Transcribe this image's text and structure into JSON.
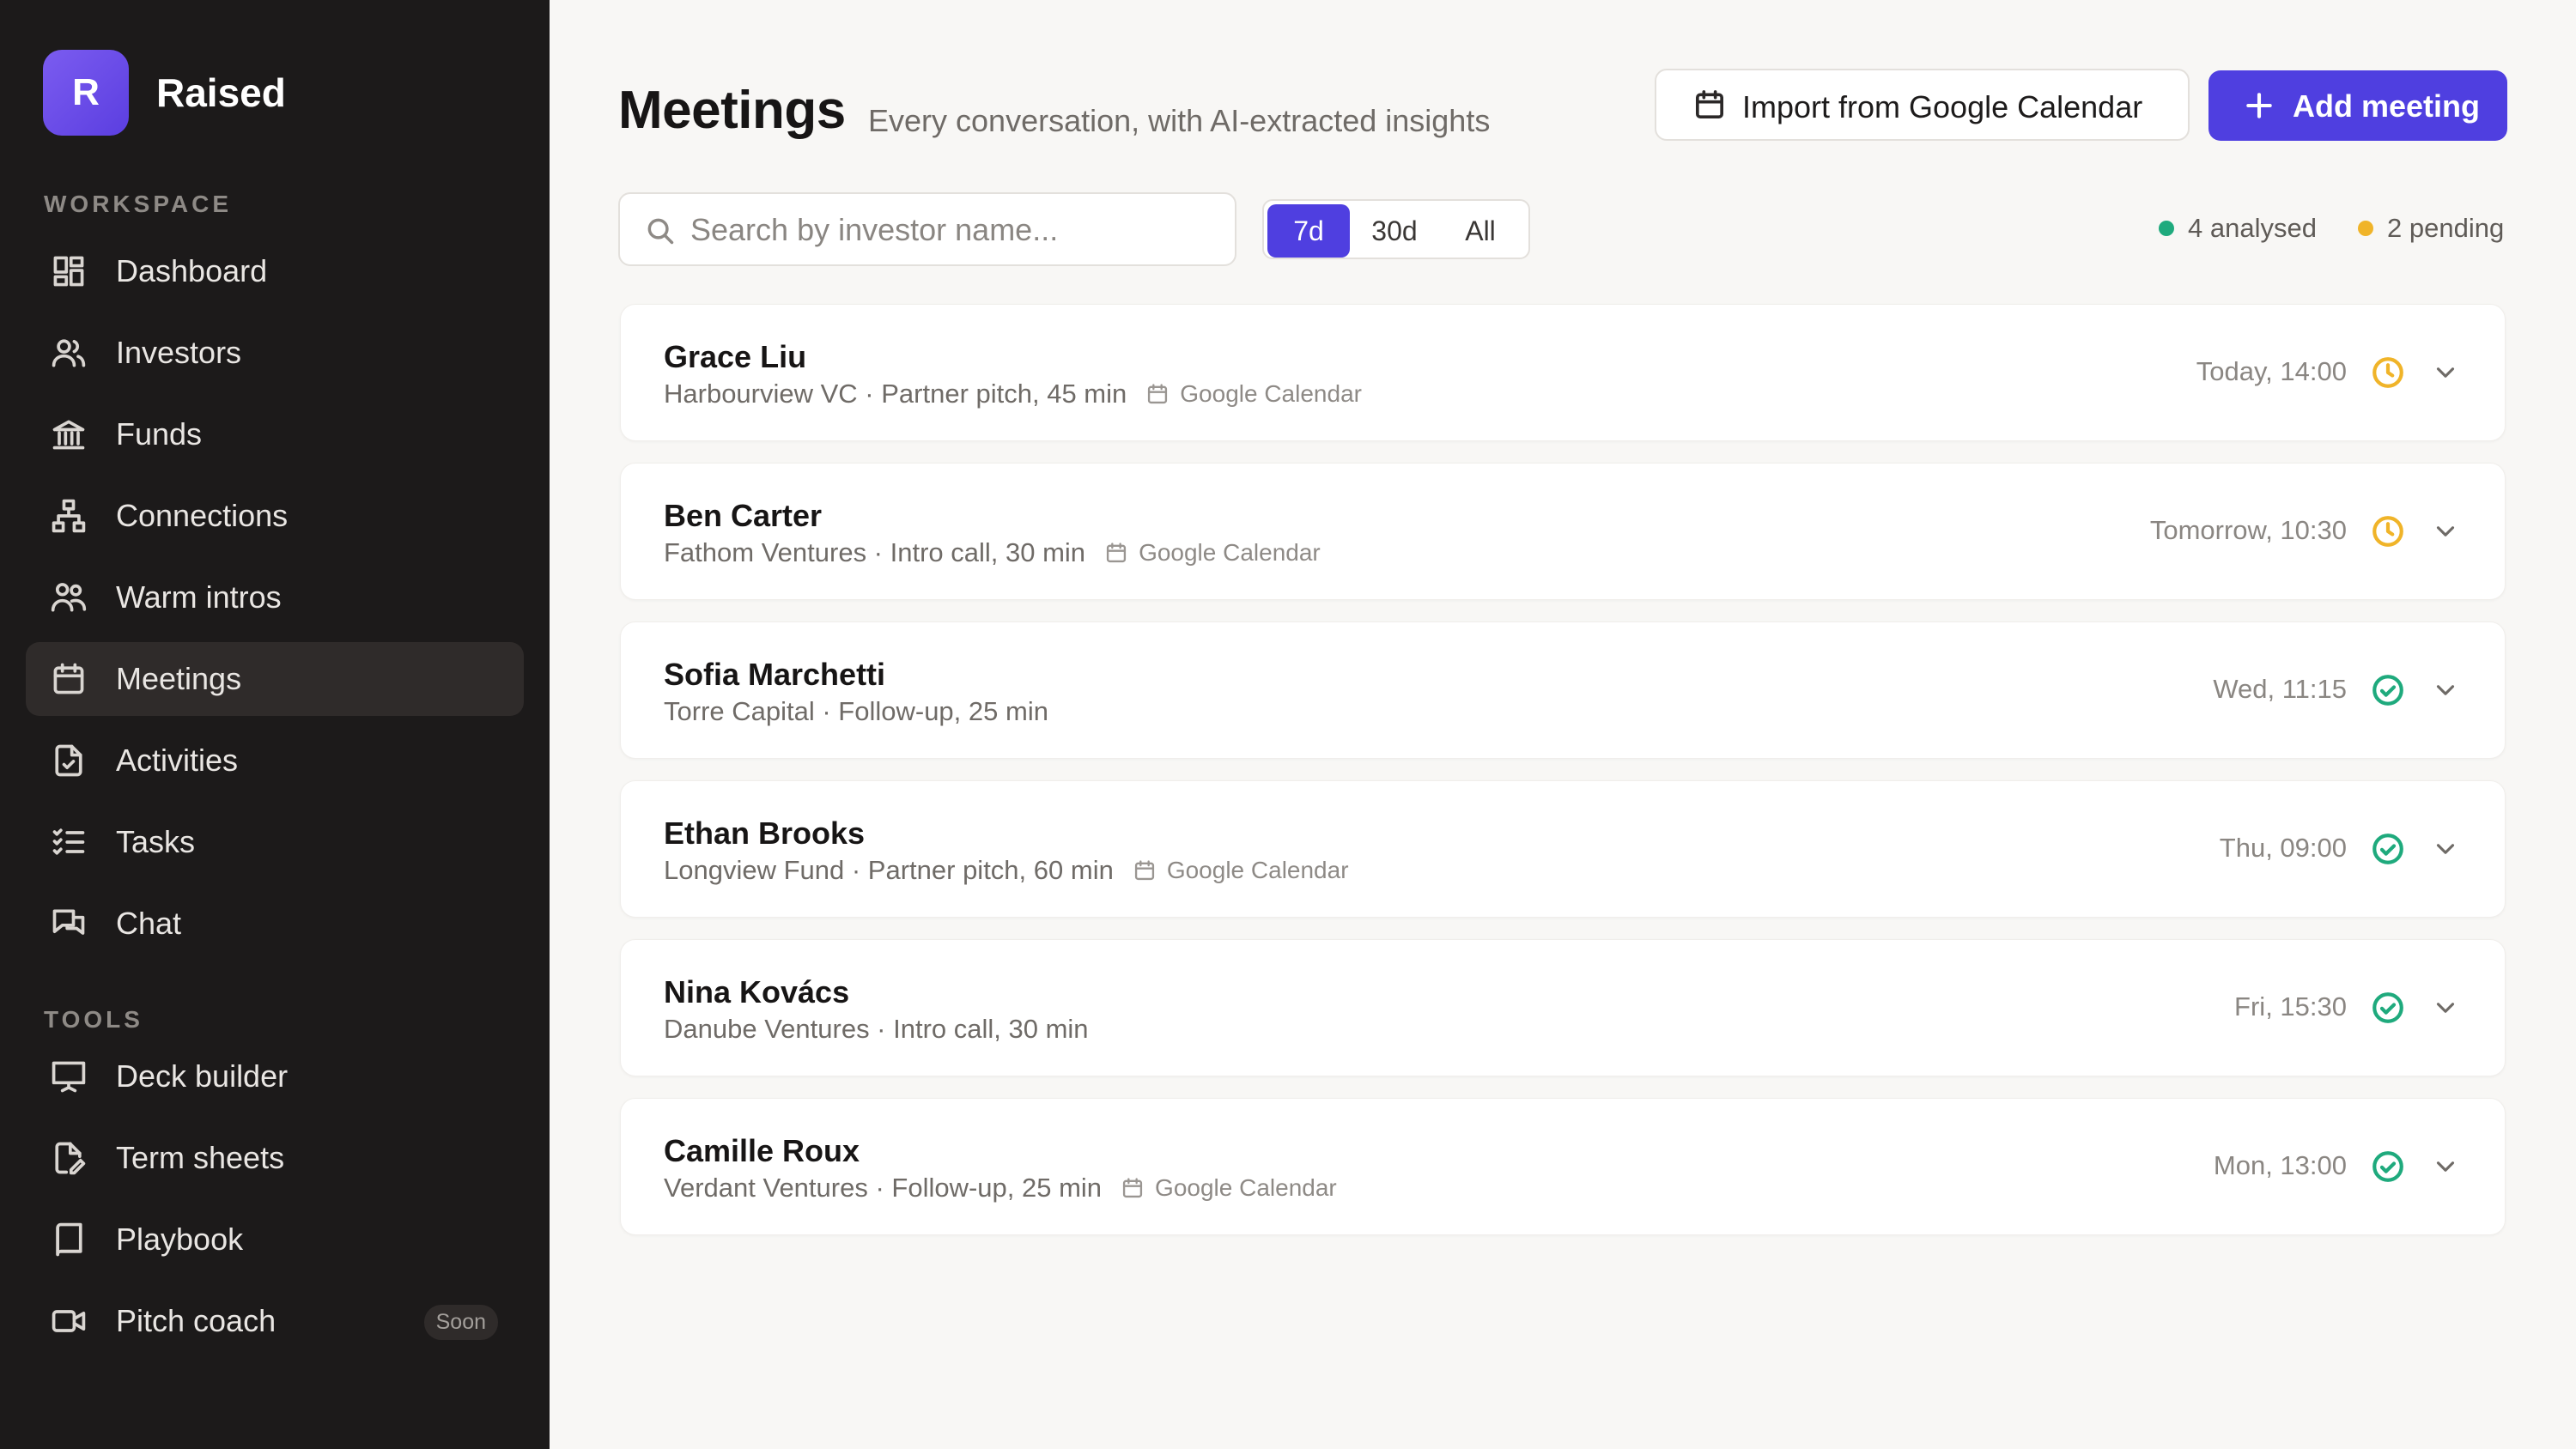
{
  "app": {
    "logo_letter": "R",
    "name": "Raised"
  },
  "sidebar": {
    "workspace_label": "WORKSPACE",
    "tools_label": "TOOLS",
    "workspace_items": [
      {
        "label": "Dashboard",
        "icon": "dashboard-icon"
      },
      {
        "label": "Investors",
        "icon": "users-icon"
      },
      {
        "label": "Funds",
        "icon": "bank-icon"
      },
      {
        "label": "Connections",
        "icon": "network-icon"
      },
      {
        "label": "Warm intros",
        "icon": "people-icon"
      },
      {
        "label": "Meetings",
        "icon": "calendar-icon",
        "active": true
      },
      {
        "label": "Activities",
        "icon": "file-check-icon"
      },
      {
        "label": "Tasks",
        "icon": "list-check-icon"
      },
      {
        "label": "Chat",
        "icon": "chat-icon"
      }
    ],
    "tool_items": [
      {
        "label": "Deck builder",
        "icon": "presentation-icon"
      },
      {
        "label": "Term sheets",
        "icon": "file-edit-icon"
      },
      {
        "label": "Playbook",
        "icon": "book-icon"
      },
      {
        "label": "Pitch coach",
        "icon": "video-icon",
        "badge": "Soon"
      }
    ]
  },
  "header": {
    "title": "Meetings",
    "subtitle": "Every conversation, with AI-extracted insights",
    "import_label": "Import from Google Calendar",
    "add_label": "Add meeting"
  },
  "toolbar": {
    "search_placeholder": "Search by investor name...",
    "filters": [
      "7d",
      "30d",
      "All"
    ],
    "active_filter": "7d",
    "analysed_text": "4 analysed",
    "pending_text": "2 pending"
  },
  "colors": {
    "accent": "#4f3fe0",
    "analysed": "#1faa7d",
    "pending": "#f0b429",
    "sidebar_bg": "#1c1a1a"
  },
  "meetings": [
    {
      "name": "Grace Liu",
      "meta": "Harbourview VC · Partner pitch, 45 min",
      "source": "Google Calendar",
      "time": "Today, 14:00",
      "status": "pending"
    },
    {
      "name": "Ben Carter",
      "meta": "Fathom Ventures · Intro call, 30 min",
      "source": "Google Calendar",
      "time": "Tomorrow, 10:30",
      "status": "pending"
    },
    {
      "name": "Sofia Marchetti",
      "meta": "Torre Capital · Follow-up, 25 min",
      "source": "",
      "time": "Wed, 11:15",
      "status": "analysed"
    },
    {
      "name": "Ethan Brooks",
      "meta": "Longview Fund · Partner pitch, 60 min",
      "source": "Google Calendar",
      "time": "Thu, 09:00",
      "status": "analysed"
    },
    {
      "name": "Nina Kovács",
      "meta": "Danube Ventures · Intro call, 30 min",
      "source": "",
      "time": "Fri, 15:30",
      "status": "analysed"
    },
    {
      "name": "Camille Roux",
      "meta": "Verdant Ventures · Follow-up, 25 min",
      "source": "Google Calendar",
      "time": "Mon, 13:00",
      "status": "analysed"
    }
  ]
}
